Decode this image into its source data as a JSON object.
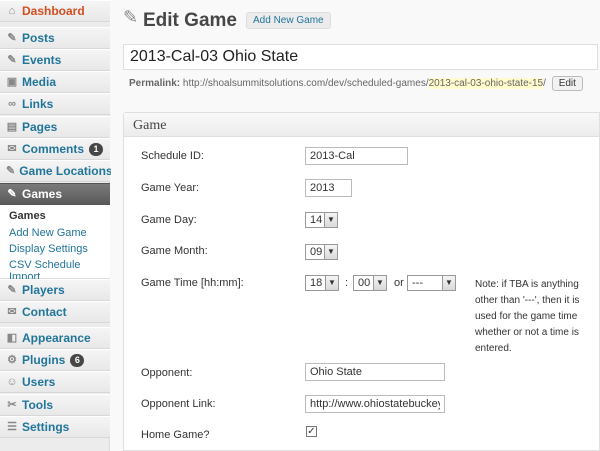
{
  "sidebar": {
    "items": [
      {
        "id": "dashboard",
        "label": "Dashboard",
        "icon": "dashboard-icon",
        "glyph": "⌂"
      },
      {
        "id": "posts",
        "label": "Posts",
        "icon": "pushpin-icon",
        "glyph": "✎"
      },
      {
        "id": "events",
        "label": "Events",
        "icon": "pushpin-icon",
        "glyph": "✎"
      },
      {
        "id": "media",
        "label": "Media",
        "icon": "media-icon",
        "glyph": "▣"
      },
      {
        "id": "links",
        "label": "Links",
        "icon": "link-icon",
        "glyph": "∞"
      },
      {
        "id": "pages",
        "label": "Pages",
        "icon": "pages-icon",
        "glyph": "▤"
      },
      {
        "id": "comments",
        "label": "Comments",
        "icon": "comment-icon",
        "glyph": "✉",
        "badge": "1"
      },
      {
        "id": "game-locations",
        "label": "Game Locations",
        "icon": "pushpin-icon",
        "glyph": "✎"
      },
      {
        "id": "games",
        "label": "Games",
        "icon": "pushpin-icon",
        "glyph": "✎"
      },
      {
        "id": "players",
        "label": "Players",
        "icon": "pushpin-icon",
        "glyph": "✎"
      },
      {
        "id": "contact",
        "label": "Contact",
        "icon": "contact-icon",
        "glyph": "✉"
      },
      {
        "id": "appearance",
        "label": "Appearance",
        "icon": "appearance-icon",
        "glyph": "◧"
      },
      {
        "id": "plugins",
        "label": "Plugins",
        "icon": "plugin-icon",
        "glyph": "⚙",
        "badge": "6"
      },
      {
        "id": "users",
        "label": "Users",
        "icon": "users-icon",
        "glyph": "☺"
      },
      {
        "id": "tools",
        "label": "Tools",
        "icon": "tools-icon",
        "glyph": "✂"
      },
      {
        "id": "settings",
        "label": "Settings",
        "icon": "settings-icon",
        "glyph": "☰"
      }
    ],
    "games_submenu": [
      "Games",
      "Add New Game",
      "Display Settings",
      "CSV Schedule Import"
    ]
  },
  "header": {
    "title": "Edit Game",
    "add_new": "Add New Game"
  },
  "post": {
    "title": "2013-Cal-03 Ohio State",
    "permalink_label": "Permalink:",
    "permalink_base": "http://shoalsummitsolutions.com/dev/scheduled-games/",
    "permalink_slug": "2013-cal-03-ohio-state-15",
    "permalink_end": "/",
    "edit_label": "Edit"
  },
  "game_box": {
    "title": "Game",
    "schedule_id_label": "Schedule ID:",
    "schedule_id_value": "2013-Cal",
    "year_label": "Game Year:",
    "year_value": "2013",
    "day_label": "Game Day:",
    "day_value": "14",
    "month_label": "Game Month:",
    "month_value": "09",
    "time_label": "Game Time [hh:mm]:",
    "hour_value": "18",
    "colon": ":",
    "minute_value": "00",
    "or_label": "or",
    "tba_value": "---",
    "note": "Note: if TBA is anything other than '---', then it is used for the game time whether or not a time is entered.",
    "opponent_label": "Opponent:",
    "opponent_value": "Ohio State",
    "opponent_link_label": "Opponent Link:",
    "opponent_link_value": "http://www.ohiostatebuckeyes.co",
    "home_game_label": "Home Game?",
    "home_game_checked": "✓"
  }
}
